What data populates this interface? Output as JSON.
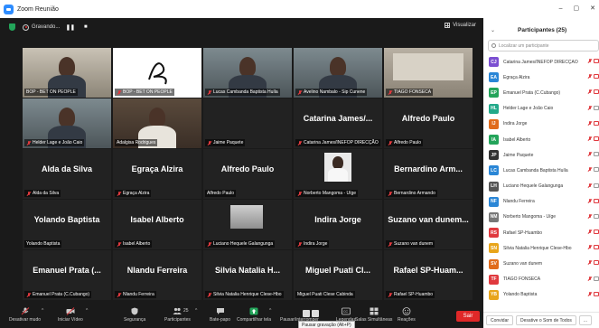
{
  "window": {
    "title": "Zoom Reunião"
  },
  "recording": {
    "status": "Gravando...",
    "view_label": "Visualizar"
  },
  "tiles": [
    {
      "label": "BOP - BET ON PEOPLE",
      "big": "",
      "kind": "person",
      "muted": false,
      "active": true
    },
    {
      "label": "BOP - BET ON PEOPLE",
      "big": "",
      "kind": "logo",
      "muted": true,
      "active": false
    },
    {
      "label": "Lucas Cambanda Baptista Huíla",
      "big": "",
      "kind": "person",
      "muted": true,
      "active": false
    },
    {
      "label": "Avelino Nambalo - Sip Cunene",
      "big": "",
      "kind": "person",
      "muted": true,
      "active": false
    },
    {
      "label": "TIAGO FONSECA",
      "big": "",
      "kind": "room",
      "muted": true,
      "active": false
    },
    {
      "label": "Helder Lage e João Caio",
      "big": "",
      "kind": "person",
      "muted": true,
      "active": false
    },
    {
      "label": "Adalgisa Rodrigues",
      "big": "",
      "kind": "person",
      "muted": false,
      "active": false
    },
    {
      "label": "Jaime Paquete",
      "big": "",
      "kind": "dark",
      "muted": true,
      "active": false
    },
    {
      "label": "Catarina James/INEFOP DIRECÇÃO",
      "big": "Catarina James/...",
      "kind": "name",
      "muted": true,
      "active": false
    },
    {
      "label": "Alfredo Paulo",
      "big": "Alfredo Paulo",
      "kind": "name",
      "muted": true,
      "active": false
    },
    {
      "label": "Alda da Silva",
      "big": "Alda da Silva",
      "kind": "name",
      "muted": true,
      "active": false
    },
    {
      "label": "Egraça Alzira",
      "big": "Egraça Alzira",
      "kind": "name",
      "muted": true,
      "active": false
    },
    {
      "label": "Alfredo Paulo",
      "big": "Alfredo Paulo",
      "kind": "name",
      "muted": false,
      "active": false
    },
    {
      "label": "Norberto Mangoma - Uíge",
      "big": "",
      "kind": "photo",
      "muted": true,
      "active": false
    },
    {
      "label": "Bernardino Armando",
      "big": "Bernardino Arm...",
      "kind": "name",
      "muted": true,
      "active": false
    },
    {
      "label": "Yolando Baptista",
      "big": "Yolando Baptista",
      "kind": "name",
      "muted": false,
      "active": false
    },
    {
      "label": "Isabel Alberto",
      "big": "Isabel Alberto",
      "kind": "name",
      "muted": true,
      "active": false
    },
    {
      "label": "Luciano Hequele Galangunga",
      "big": "",
      "kind": "building",
      "muted": true,
      "active": false
    },
    {
      "label": "Indira Jorge",
      "big": "Indira Jorge",
      "kind": "name",
      "muted": true,
      "active": false
    },
    {
      "label": "Suzano van dunem",
      "big": "Suzano van dunem...",
      "kind": "name",
      "muted": true,
      "active": false
    },
    {
      "label": "Emanuel Prata (C.Cubango)",
      "big": "Emanuel Prata (...",
      "kind": "name",
      "muted": true,
      "active": false
    },
    {
      "label": "Nlandu Ferreira",
      "big": "Nlandu Ferreira",
      "kind": "name",
      "muted": true,
      "active": false
    },
    {
      "label": "Silvia Natalia Henrique Clese-Hbo",
      "big": "Silvia Natalia H...",
      "kind": "name",
      "muted": true,
      "active": false
    },
    {
      "label": "Miguel Puati Clese Cabinda",
      "big": "Miguel Puati Cl...",
      "kind": "name",
      "muted": false,
      "active": false
    },
    {
      "label": "Rafael SP-Huambo",
      "big": "Rafael SP-Huam...",
      "kind": "name",
      "muted": true,
      "active": false
    }
  ],
  "toolbar": {
    "mute": "Desativar mudo",
    "video": "Iniciar Vídeo",
    "security": "Segurança",
    "participants": "Participantes",
    "participants_count": "25",
    "chat": "Bate-papo",
    "share": "Compartilhar tela",
    "record": "Pausar/interromper",
    "subtitles": "Legendas",
    "breakout": "Salas Simultâneas",
    "reactions": "Reações",
    "leave": "Sair",
    "tooltip": "Pausar gravação (Alt+P)"
  },
  "panel": {
    "title": "Participantes (25)",
    "search_placeholder": "Localizar um participante",
    "participants": [
      {
        "initials": "CJ",
        "name": "Catarina James/INEFOP DIRECÇÃO",
        "color": "#7b4fd1",
        "cam": true
      },
      {
        "initials": "EA",
        "name": "Egraça Alzira",
        "color": "#2a86d6",
        "cam": true
      },
      {
        "initials": "EP",
        "name": "Emanuel Prata (C.Cubango)",
        "color": "#23a45a",
        "cam": true
      },
      {
        "initials": "HL",
        "name": "Helder Lage e João Caio",
        "color": "#22a98a",
        "cam": false
      },
      {
        "initials": "IJ",
        "name": "Indira Jorge",
        "color": "#e06b1b",
        "cam": true
      },
      {
        "initials": "IA",
        "name": "Isabel Alberto",
        "color": "#23a45a",
        "cam": true
      },
      {
        "initials": "JP",
        "name": "Jaime Paquete",
        "color": "#333333",
        "cam": false
      },
      {
        "initials": "LC",
        "name": "Lucas Cambanda Baptista Huíla",
        "color": "#2a86d6",
        "cam": false
      },
      {
        "initials": "LH",
        "name": "Luciano Hequele Galangunga",
        "color": "#555555",
        "cam": false
      },
      {
        "initials": "NF",
        "name": "Nlandu Ferreira",
        "color": "#2a86d6",
        "cam": true
      },
      {
        "initials": "NM",
        "name": "Norberto Mangoma - Uíge",
        "color": "#777777",
        "cam": false
      },
      {
        "initials": "RS",
        "name": "Rafael SP-Huambo",
        "color": "#e0393e",
        "cam": true
      },
      {
        "initials": "SN",
        "name": "Silvia Natalia Henrique Clese-Hbo",
        "color": "#e8a51b",
        "cam": true
      },
      {
        "initials": "SV",
        "name": "Suzano van dunem",
        "color": "#e06b1b",
        "cam": true
      },
      {
        "initials": "TF",
        "name": "TIAGO FONSECA",
        "color": "#e0393e",
        "cam": false
      },
      {
        "initials": "YB",
        "name": "Yolando Baptista",
        "color": "#e8a51b",
        "cam": true
      }
    ],
    "invite": "Convidar",
    "mute_all": "Desative o Som de Todos",
    "more": "..."
  }
}
